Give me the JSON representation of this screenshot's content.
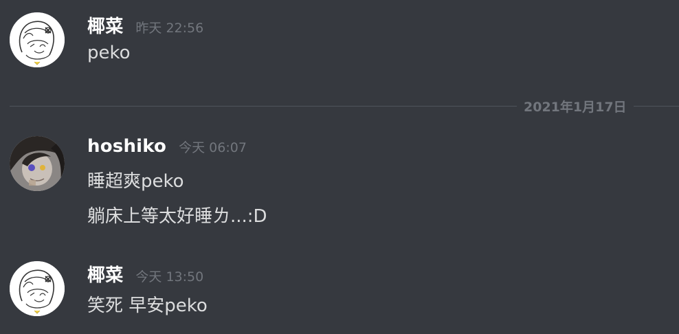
{
  "messages": [
    {
      "author": "椰菜",
      "timestamp": "昨天 22:56",
      "avatar_icon": "sketch-girl-avatar",
      "lines": [
        "peko"
      ]
    },
    {
      "author": "hoshiko",
      "timestamp": "今天 06:07",
      "avatar_icon": "photo-avatar",
      "lines": [
        "睡超爽peko",
        "躺床上等太好睡ㄌ...:D"
      ]
    },
    {
      "author": "椰菜",
      "timestamp": "今天 13:50",
      "avatar_icon": "sketch-girl-avatar",
      "lines": [
        "笑死 早安peko"
      ]
    }
  ],
  "date_divider": {
    "label": "2021年1月17日"
  },
  "colors": {
    "background": "#36393f",
    "username": "#ffffff",
    "message_text": "#dcddde",
    "timestamp": "#72767d",
    "divider": "#4f545c"
  }
}
